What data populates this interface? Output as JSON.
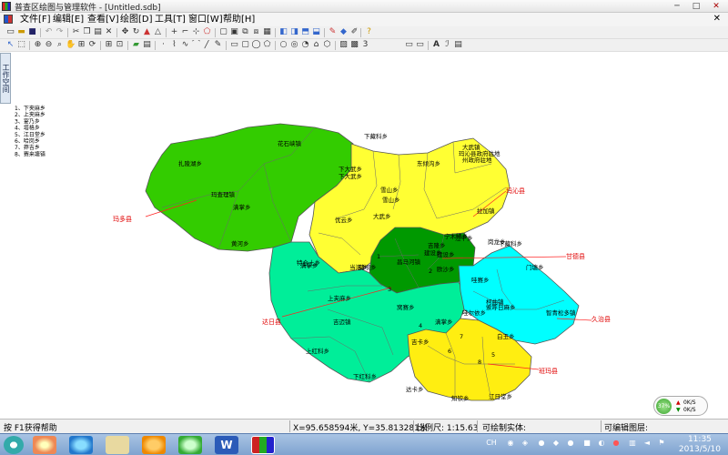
{
  "window": {
    "title": "普查区绘图与管理软件 - [Untitled.sdb]",
    "minimize": "─",
    "maximize": "□",
    "close": "✕"
  },
  "menu": {
    "items": [
      "文件[F]",
      "编辑[E]",
      "查看[V]",
      "绘图[D]",
      "工具[T]",
      "窗口[W]",
      "帮助[H]"
    ],
    "close": "✕"
  },
  "toolbar1_numeral": "3",
  "side_panel": {
    "label": "工作空间"
  },
  "map": {
    "legend": [
      "1、下夹麻乡",
      "2、上夹麻乡",
      "3、宴乃乡",
      "4、塔格乡",
      "5、江日堂乡",
      "6、哈岗乡",
      "7、莽吉乡",
      "8、赛来塘镇"
    ],
    "township_labels": [
      "花石峡镇",
      "下藏科乡",
      "扎陵湖乡",
      "满掌乡",
      "黄河乡",
      "玛查理镇",
      "大武镇",
      "玛沁县政府驻地",
      "州政府驻地",
      "东倾沟乡",
      "下大武乡",
      "雪山乡",
      "拉加镇",
      "优云乡",
      "大武乡",
      "当洛乡",
      "昌马河镇",
      "吉隆乡",
      "建设乡",
      "江千乡",
      "门塘乡",
      "柯曲镇",
      "欧沙乡",
      "下藏科乡",
      "哇赛乡",
      "下红科乡",
      "上红科乡",
      "满掌乡",
      "窝赛乡",
      "满掌乡",
      "吉卡乡",
      "知钦乡",
      "江日堂乡",
      "白玉乡",
      "智青松多镇",
      "达卡乡",
      "哇尔依乡",
      "索呼日麻乡",
      "岗龙乡",
      "上夹麻乡",
      "下大武乡",
      "吉迈镇",
      "特合土乡",
      "莫坝乡",
      "雪山乡",
      "建设乡",
      "宁木特乡",
      "1",
      "2",
      "3",
      "4",
      "5",
      "6",
      "7",
      "8"
    ],
    "county_labels": [
      "玛多县",
      "玛沁县",
      "甘德县",
      "达日县",
      "久治县",
      "班玛县"
    ],
    "region_colors": {
      "madoi": "#33cc00",
      "maqen": "#ffff33",
      "gade": "#009900",
      "darlag": "#00ee99",
      "jigzhi": "#00ffff",
      "baima": "#ffee11"
    }
  },
  "status": {
    "help": "按 F1获得帮助",
    "coords": "X=95.658594米, Y=35.813281米",
    "scale": "比例尺: 1:15.63",
    "drawable": "可绘制实体:",
    "editable": "可编辑图层:"
  },
  "meter": {
    "percent": "37%",
    "up": "0K/S",
    "down": "0K/S"
  },
  "taskbar": {
    "lang": "CH",
    "time": "11:35",
    "date": "2013/5/10"
  }
}
